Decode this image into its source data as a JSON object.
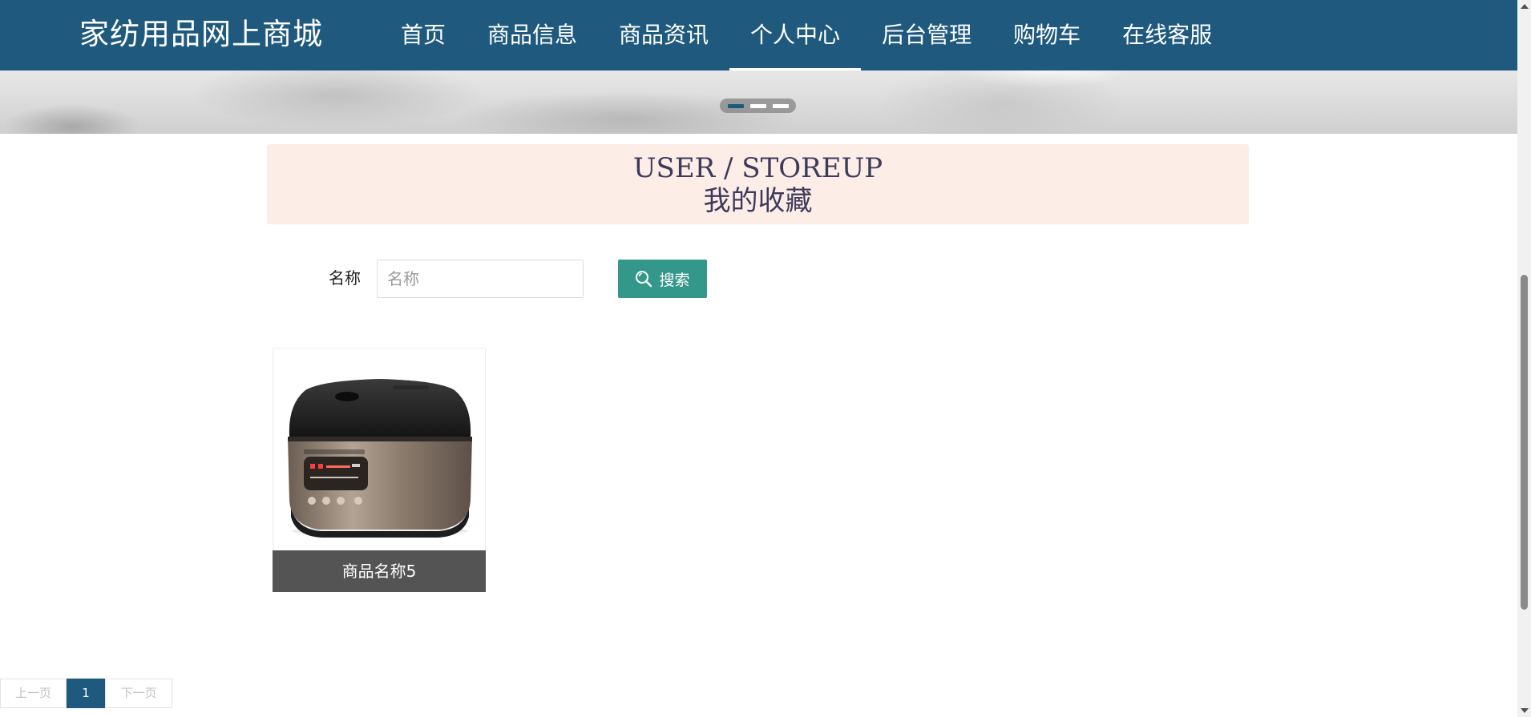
{
  "header": {
    "brand": "家纺用品网上商城",
    "nav": [
      {
        "label": "首页",
        "active": false
      },
      {
        "label": "商品信息",
        "active": false
      },
      {
        "label": "商品资讯",
        "active": false
      },
      {
        "label": "个人中心",
        "active": true
      },
      {
        "label": "后台管理",
        "active": false
      },
      {
        "label": "购物车",
        "active": false
      },
      {
        "label": "在线客服",
        "active": false
      }
    ]
  },
  "banner": {
    "slide_count": 3,
    "active_slide": 1
  },
  "section": {
    "title_en": "USER / STOREUP",
    "title_cn": "我的收藏"
  },
  "search": {
    "label": "名称",
    "placeholder": "名称",
    "value": "",
    "button_label": "搜索",
    "button_icon": "search-icon"
  },
  "items": [
    {
      "name": "商品名称5",
      "image": "rice-cooker-image"
    }
  ],
  "pagination": {
    "prev_label": "上一页",
    "current_page": "1",
    "next_label": "下一页"
  },
  "colors": {
    "header_bg": "#1f5a7e",
    "title_panel_bg": "#fcede6",
    "title_text": "#3d3a5c",
    "search_button_bg": "#33988a",
    "caption_bg": "#545454"
  }
}
